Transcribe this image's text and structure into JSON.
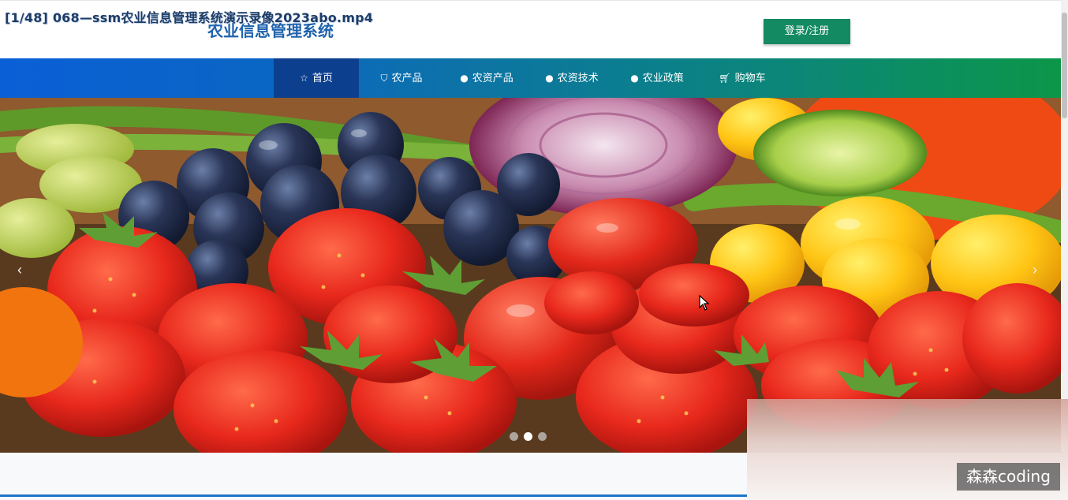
{
  "video_title": "[1/48] 068—ssm农业信息管理系统演示录像2023abo.mp4",
  "site": {
    "title": "农业信息管理系统"
  },
  "header": {
    "login_label": "登录/注册"
  },
  "nav": {
    "items": [
      {
        "label": "首页",
        "icon": "star-icon",
        "active": true
      },
      {
        "label": "农产品",
        "icon": "bag-icon",
        "active": false
      },
      {
        "label": "农资产品",
        "icon": "info-icon",
        "active": false
      },
      {
        "label": "农资技术",
        "icon": "question-icon",
        "active": false
      },
      {
        "label": "农业政策",
        "icon": "info-icon",
        "active": false
      },
      {
        "label": "购物车",
        "icon": "cart-icon",
        "active": false
      }
    ]
  },
  "banner": {
    "description": "fresh fruits: strawberries, grapes, tomatoes, onion",
    "prev_symbol": "‹",
    "next_symbol": "›",
    "slide_count": 3,
    "active_slide": 2
  },
  "watermark": "森森coding",
  "colors": {
    "brand_blue": "#1f63ad",
    "login_green": "#138a62",
    "nav_active": "#0c3f8e"
  }
}
